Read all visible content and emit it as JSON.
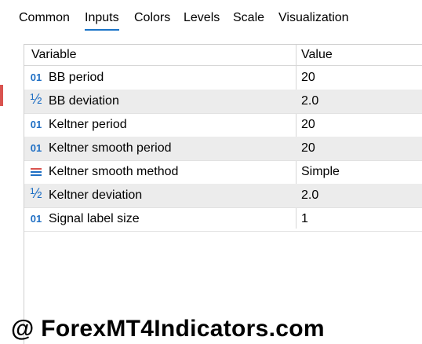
{
  "tabs": [
    {
      "label": "Common"
    },
    {
      "label": "Inputs"
    },
    {
      "label": "Colors"
    },
    {
      "label": "Levels"
    },
    {
      "label": "Scale"
    },
    {
      "label": "Visualization"
    }
  ],
  "active_tab": "Inputs",
  "table": {
    "headers": {
      "variable": "Variable",
      "value": "Value"
    },
    "rows": [
      {
        "icon": "int-icon",
        "icon_text": "01",
        "variable": "BB period",
        "value": "20"
      },
      {
        "icon": "double-icon",
        "icon_text": "½",
        "variable": "BB deviation",
        "value": "2.0"
      },
      {
        "icon": "int-icon",
        "icon_text": "01",
        "variable": "Keltner period",
        "value": "20"
      },
      {
        "icon": "int-icon",
        "icon_text": "01",
        "variable": "Keltner smooth period",
        "value": "20"
      },
      {
        "icon": "enum-icon",
        "icon_text": "",
        "variable": "Keltner smooth method",
        "value": "Simple"
      },
      {
        "icon": "double-icon",
        "icon_text": "½",
        "variable": "Keltner deviation",
        "value": "2.0"
      },
      {
        "icon": "int-icon",
        "icon_text": "01",
        "variable": "Signal label size",
        "value": "1"
      }
    ]
  },
  "watermark": "@ ForexMT4Indicators.com",
  "colors": {
    "accent": "#1a73c8",
    "row_alt": "#ececec",
    "icon": "#1f6fc4"
  }
}
